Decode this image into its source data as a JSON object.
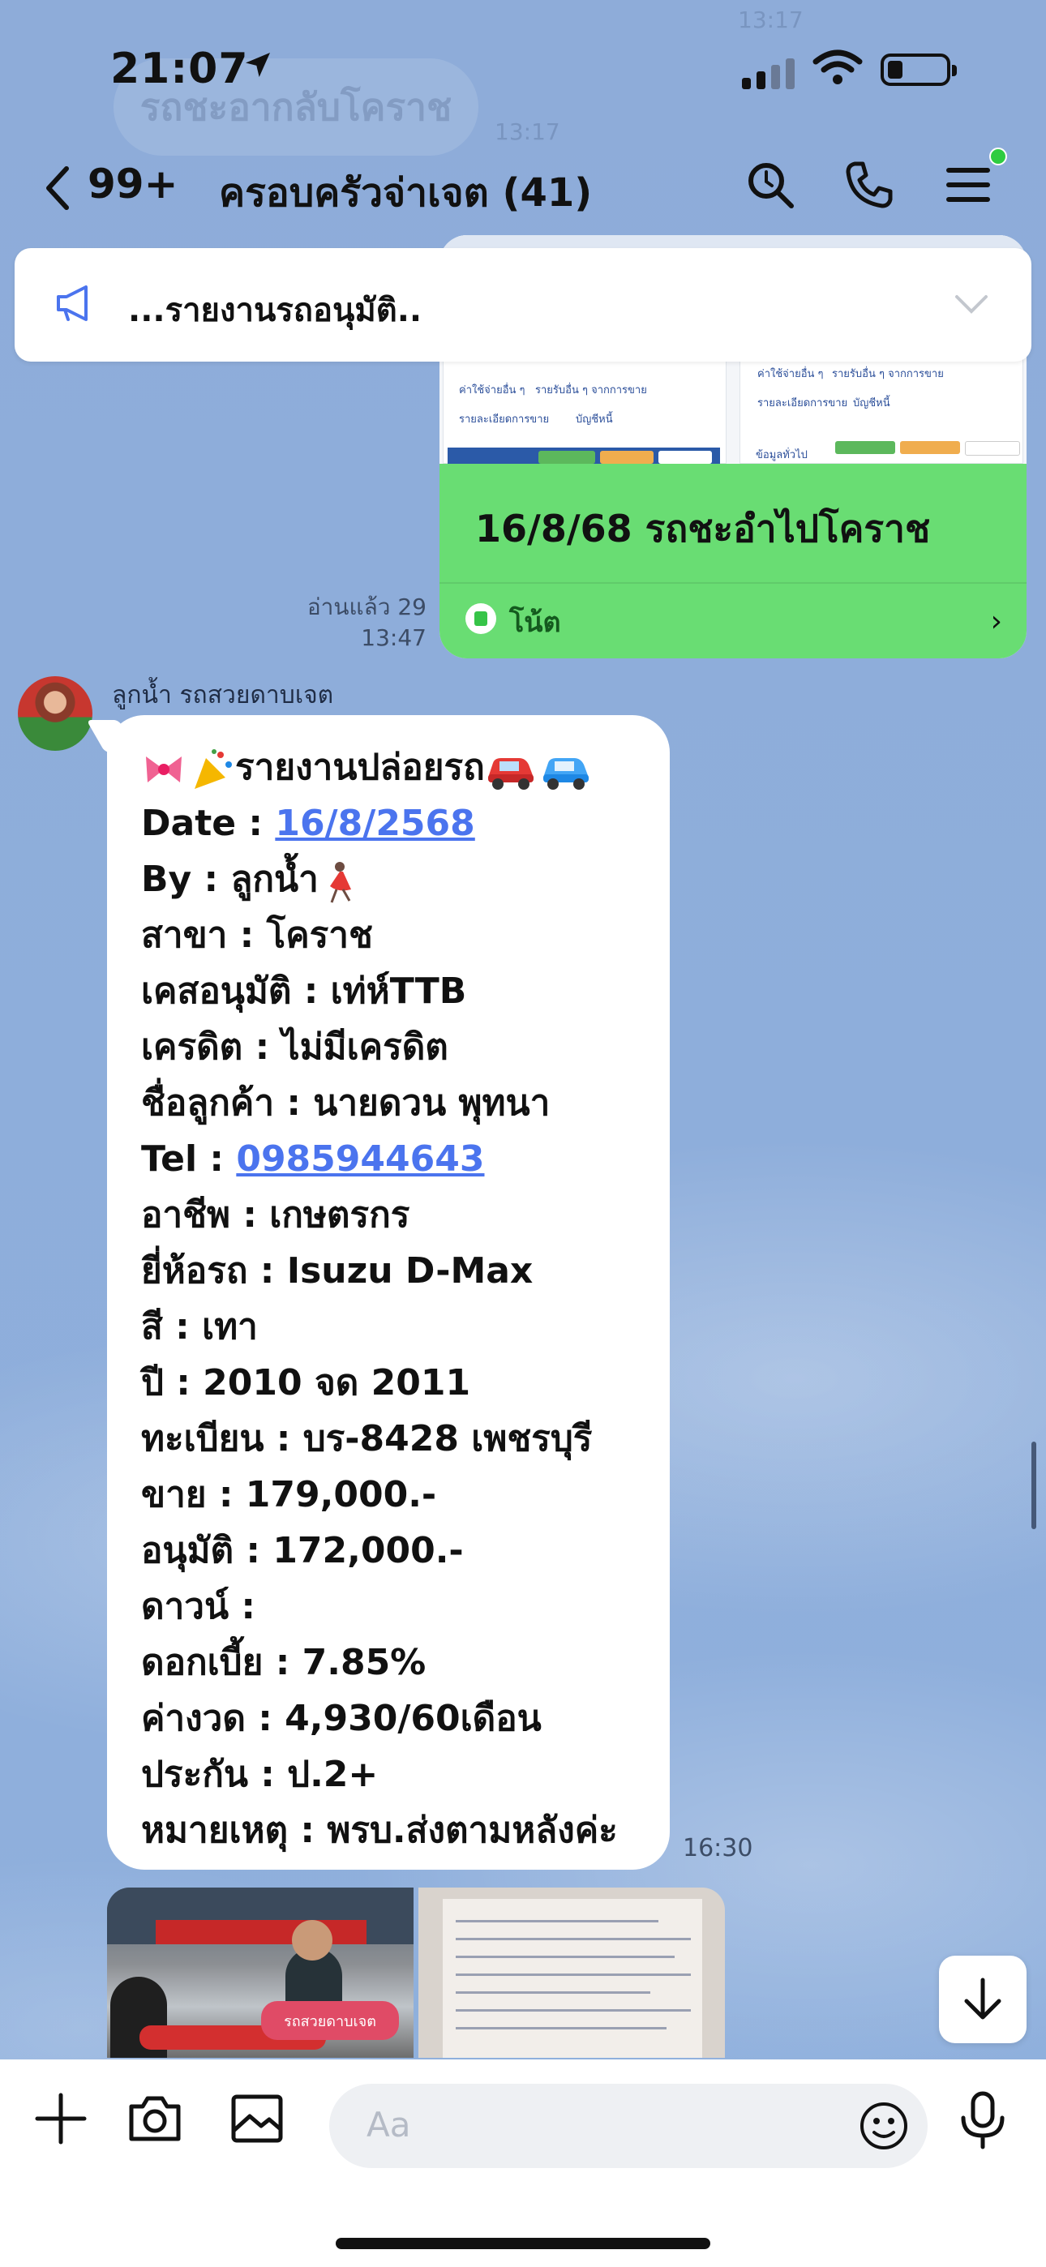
{
  "status_bar": {
    "time": "21:07"
  },
  "background_ghost": {
    "pill_text": "รถชะอากลับโคราช",
    "time_top": "13:17",
    "time_mid": "13:17"
  },
  "nav": {
    "unread_count": "99+",
    "chat_title": "ครอบครัวจ่าเจต (41)"
  },
  "announcement": {
    "text": "...รายงานรถอนุมัติ.."
  },
  "note_card": {
    "title": "16/8/68 รถชะอำไปโคราช",
    "label": "โน้ต",
    "thumb_texts": [
      "ค่าใช้จ่ายอื่น ๆ",
      "รายรับอื่น ๆ จากการขาย",
      "รายละเอียดการขาย",
      "บัญชีหนี้",
      "ข้อมูลทั่วไป"
    ]
  },
  "read_receipt": {
    "line1": "อ่านแล้ว 29",
    "line2": "13:47"
  },
  "message": {
    "sender": "ลูกน้ำ รถสวยดาบเจต",
    "time": "16:30",
    "lines": {
      "l1": "รายงานปล่อยรถ",
      "l2_label": "Date : ",
      "l2_link": "16/8/2568",
      "l3": "By : ลูกน้ำ",
      "l4": "สาขา : โคราช",
      "l5": "เคสอนุมัติ : เท่ห์TTB",
      "l6": "เครดิต : ไม่มีเครดิต",
      "l7": "ชื่อลูกค้า : นายดวน พุทนา",
      "l8_label": "Tel : ",
      "l8_link": "0985944643",
      "l9": "อาชีพ : เกษตรกร",
      "l10": "ยี่ห้อรถ : Isuzu D-Max",
      "l11": "สี :  เทา",
      "l12": "ปี : 2010 จด 2011",
      "l13": "ทะเบียน : บร-8428 เพชรบุรี",
      "l14": "ขาย : 179,000.-",
      "l15": "อนุมัติ : 172,000.-",
      "l16": "ดาวน์ :",
      "l17": "ดอกเบี้ย : 7.85%",
      "l18": "ค่างวด : 4,930/60เดือน",
      "l19": "ประกัน : ป.2+",
      "l20": "หมายเหตุ : พรบ.ส่งตามหลังค่ะ"
    }
  },
  "photo_banner": "รถสวยดาบเจต",
  "input": {
    "placeholder": "Aa"
  },
  "colors": {
    "background": "#8aa9d8",
    "note_green": "#69dd73",
    "link": "#4b74ee",
    "online_dot": "#2ecc40"
  }
}
